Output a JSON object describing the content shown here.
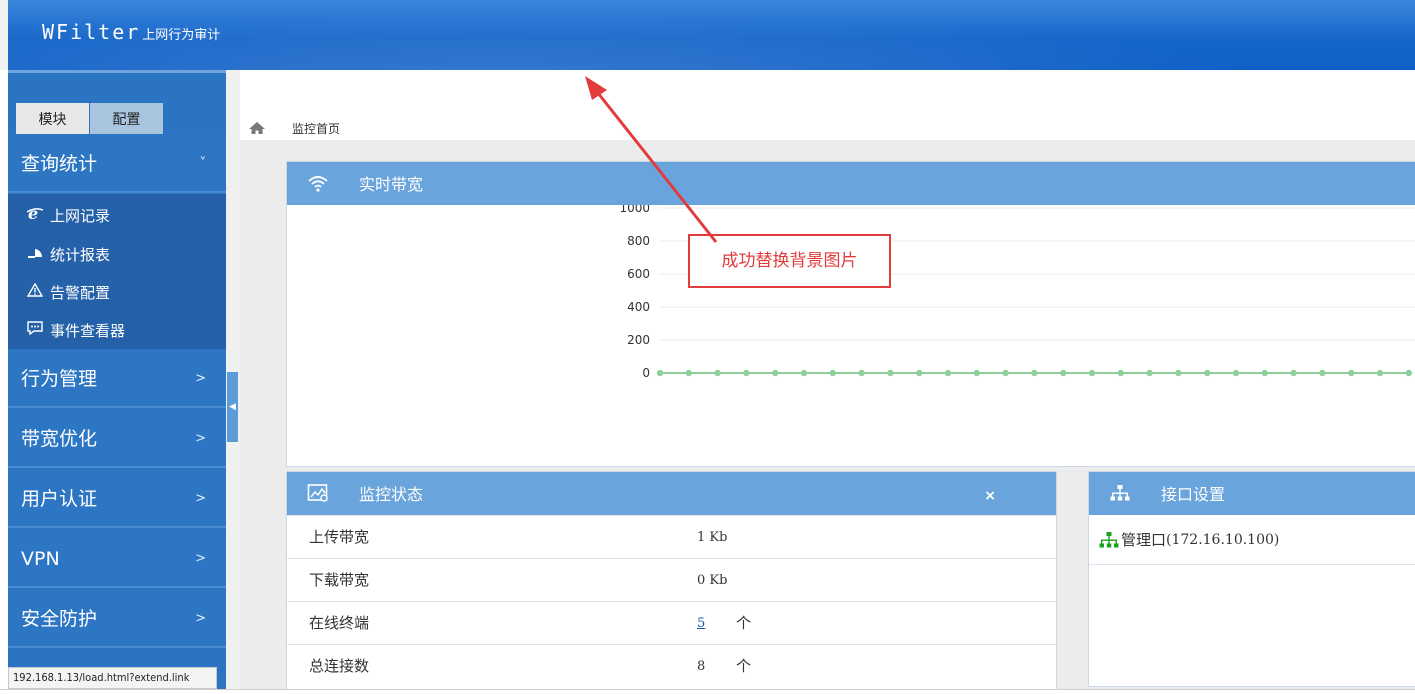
{
  "header": {
    "brand": "WFilter",
    "subtitle": "上网行为审计"
  },
  "sidebar": {
    "tabs": [
      "模块",
      "配置"
    ],
    "sections": [
      {
        "label": "查询统计",
        "chevron": "˅"
      },
      {
        "label": "行为管理",
        "chevron": ">"
      },
      {
        "label": "带宽优化",
        "chevron": ">"
      },
      {
        "label": "用户认证",
        "chevron": ">"
      },
      {
        "label": "VPN",
        "chevron": ">"
      },
      {
        "label": "安全防护",
        "chevron": ">"
      }
    ],
    "subitems": [
      {
        "label": "上网记录",
        "icon": "ie-icon"
      },
      {
        "label": "统计报表",
        "icon": "pie-chart-icon"
      },
      {
        "label": "告警配置",
        "icon": "warning-icon"
      },
      {
        "label": "事件查看器",
        "icon": "chat-icon"
      }
    ]
  },
  "status_url": "192.168.1.13/load.html?extend.link",
  "breadcrumb": {
    "home_icon": "home-icon",
    "current": "监控首页"
  },
  "bandwidth_panel": {
    "title": "实时带宽",
    "icon": "wifi-icon"
  },
  "chart_data": {
    "type": "line",
    "title": "",
    "xlabel": "",
    "ylabel": "",
    "ylim": [
      0,
      1000
    ],
    "yticks": [
      0,
      200,
      400,
      600,
      800,
      1000
    ],
    "series": [
      {
        "values": [
          0,
          0,
          0,
          0,
          0,
          0,
          0,
          0,
          0,
          0,
          0,
          0,
          0,
          0,
          0,
          0,
          0,
          0,
          0,
          0,
          0,
          0,
          0,
          0,
          0,
          0,
          0
        ],
        "color": "#8fcf9a"
      }
    ],
    "grid": true
  },
  "status_panel": {
    "title": "监控状态",
    "close": "×",
    "icon": "image-chart-icon",
    "rows": [
      {
        "label": "上传带宽",
        "value": "1 Kb",
        "unit": ""
      },
      {
        "label": "下载带宽",
        "value": "0 Kb",
        "unit": ""
      },
      {
        "label": "在线终端",
        "value": "5",
        "unit": "个",
        "link": true
      },
      {
        "label": "总连接数",
        "value": "8",
        "unit": "个"
      }
    ]
  },
  "interface_panel": {
    "title": "接口设置",
    "icon": "network-icon",
    "rows": [
      {
        "name": "管理口",
        "ip": "(172.16.10.100)"
      }
    ]
  },
  "annotation": {
    "text": "成功替换背景图片",
    "color": "#e23b3b"
  }
}
